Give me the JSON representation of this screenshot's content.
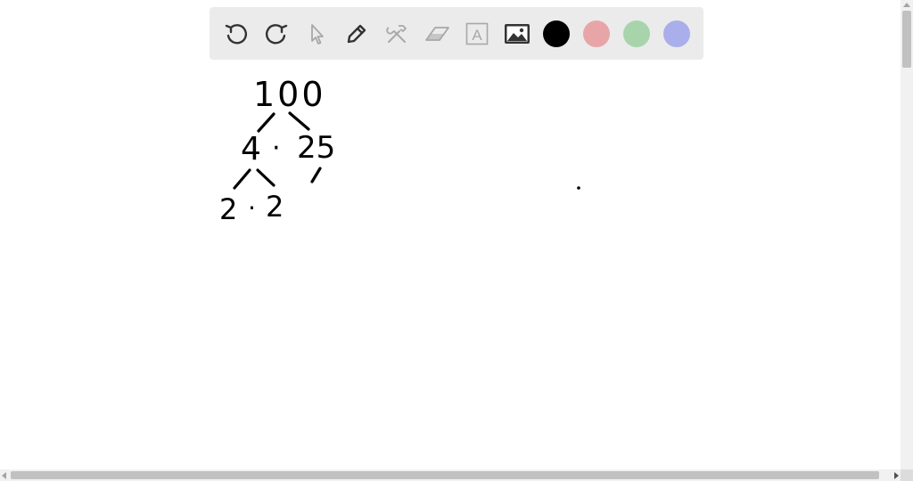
{
  "toolbar": {
    "tools": [
      {
        "name": "undo-icon"
      },
      {
        "name": "redo-icon"
      },
      {
        "name": "select-pointer-icon"
      },
      {
        "name": "pen-icon"
      },
      {
        "name": "tools-icon"
      },
      {
        "name": "eraser-icon"
      },
      {
        "name": "text-box-icon",
        "glyph": "A"
      },
      {
        "name": "image-icon"
      }
    ],
    "colors": {
      "black": "#000000",
      "red": "#e8a5a8",
      "green": "#a8d4ac",
      "blue": "#aaaeea"
    },
    "icon_color": "#333333",
    "disabled_icon_color": "#a8a8a8"
  },
  "drawing": {
    "ink_color": "#000000",
    "root": "100",
    "level1_left": "4",
    "level1_operator": "·",
    "level1_right": "25",
    "level2_left": "2",
    "level2_operator": "·",
    "level2_right": "2"
  }
}
